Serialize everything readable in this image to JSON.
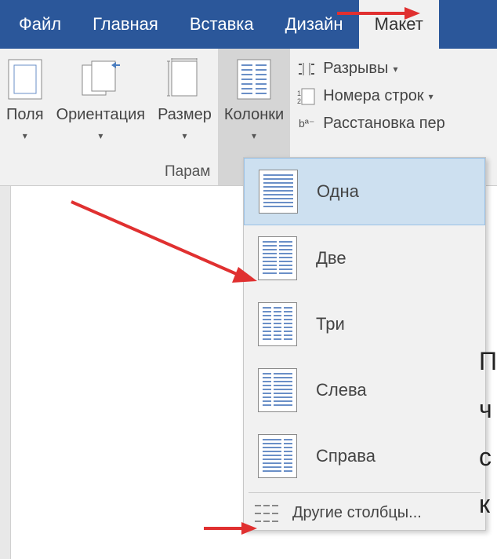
{
  "tabs": {
    "file": "Файл",
    "home": "Главная",
    "insert": "Вставка",
    "design": "Дизайн",
    "layout": "Макет"
  },
  "ribbon": {
    "margins": "Поля",
    "orientation": "Ориентация",
    "size": "Размер",
    "columns": "Колонки",
    "breaks": "Разрывы",
    "line_numbers": "Номера строк",
    "hyphenation": "Расстановка пер",
    "group_label": "Парам"
  },
  "columns_menu": {
    "one": "Одна",
    "two": "Две",
    "three": "Три",
    "left": "Слева",
    "right": "Справа",
    "more": "Другие столбцы..."
  },
  "doc_peek": [
    "П",
    "ч",
    "с",
    "к"
  ]
}
